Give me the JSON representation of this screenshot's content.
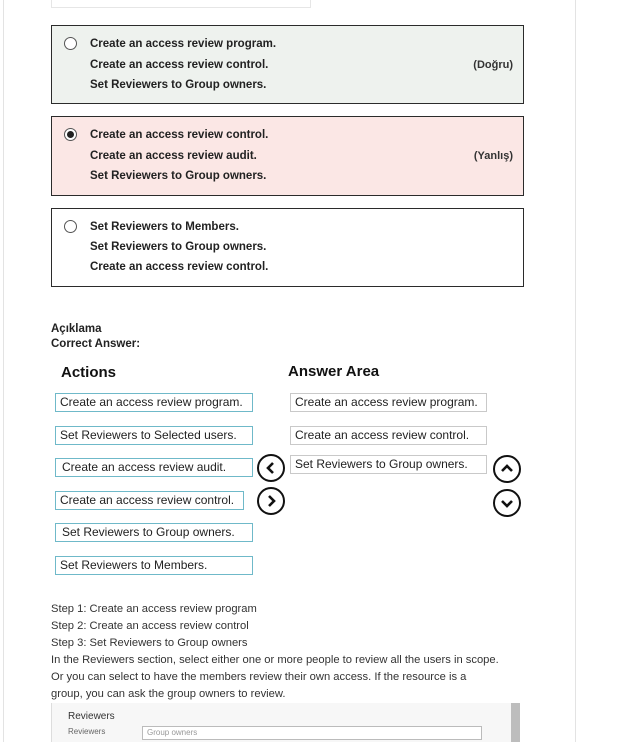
{
  "options": [
    {
      "lines": [
        "Create an access review program.",
        "Create an access review control.",
        "Set Reviewers to Group owners."
      ],
      "verdict": "(Doğru)",
      "selected": false
    },
    {
      "lines": [
        "Create an access review control.",
        "Create an access review audit.",
        "Set Reviewers to Group owners."
      ],
      "verdict": "(Yanlış)",
      "selected": true
    },
    {
      "lines": [
        "Set Reviewers to Members.",
        "Set Reviewers to Group owners.",
        "Create an access review control."
      ],
      "verdict": "",
      "selected": false
    }
  ],
  "explanation_label": "Açıklama",
  "correct_answer_label": "Correct Answer:",
  "answer_area": {
    "actions_title": "Actions",
    "answer_title": "Answer Area",
    "actions": [
      "Create an access review program.",
      "Set Reviewers to Selected users.",
      "Create an access review audit.",
      "Create an access review control.",
      "Set Reviewers to Group owners.",
      "Set Reviewers to Members."
    ],
    "answers": [
      "Create an access review program.",
      "Create an access review control.",
      "Set Reviewers to Group owners."
    ]
  },
  "steps": [
    "Step 1: Create an access review program",
    "Step 2: Create an access review control",
    "Step 3: Set Reviewers to Group owners"
  ],
  "paragraph": "In the Reviewers section, select either one or more people to review all the users in scope. Or you can select to have the members review their own access. If the resource is a group, you can ask the group owners to review.",
  "screenshot": {
    "label": "Reviewers",
    "sublabel": "Reviewers",
    "input_value": "Group owners"
  },
  "colors": {
    "correct_bg": "#eef2ee",
    "wrong_bg": "#fbe7e5",
    "action_border": "#6fb9c9"
  },
  "icons": [
    "radio-icon",
    "move-left-icon",
    "move-right-icon",
    "move-up-icon",
    "move-down-icon"
  ]
}
